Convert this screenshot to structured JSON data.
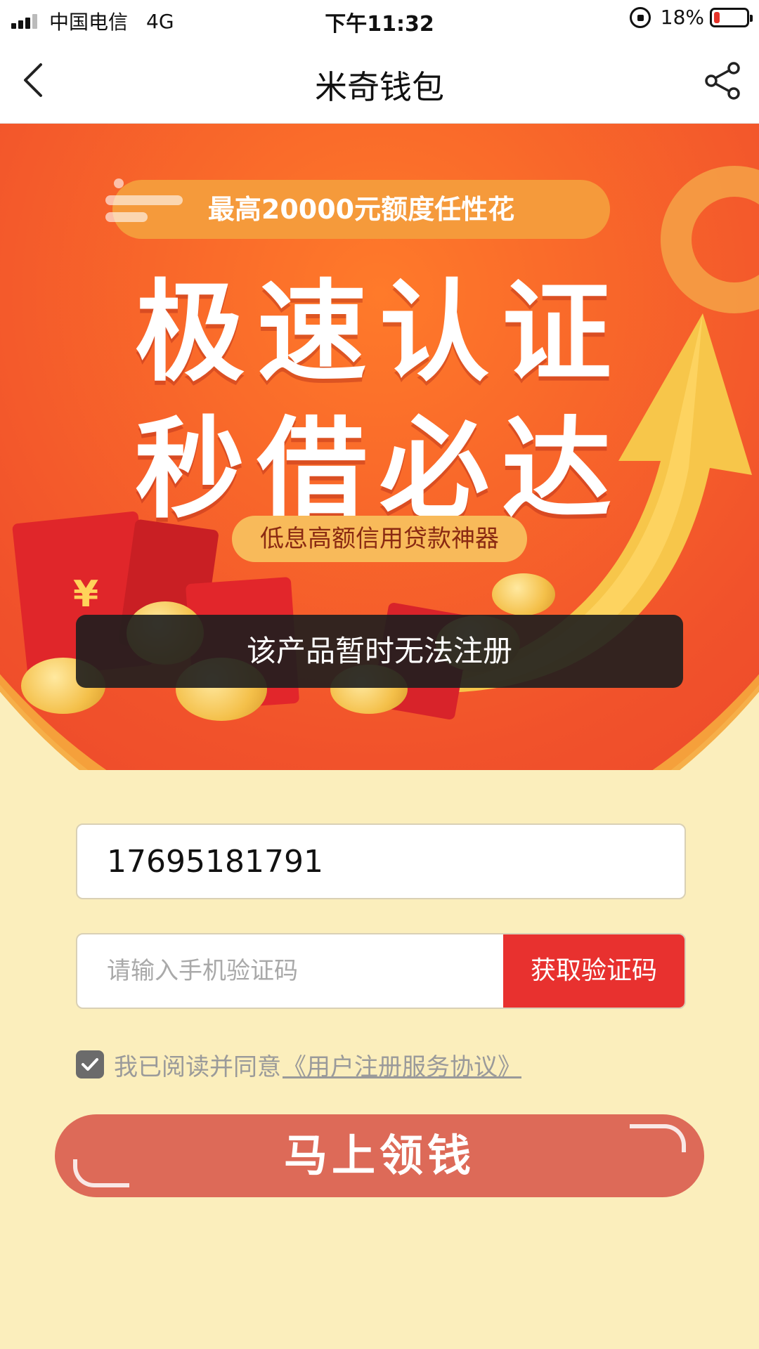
{
  "status_bar": {
    "carrier": "中国电信",
    "network": "4G",
    "time": "下午11:32",
    "battery": "18%",
    "battery_level": 0.18
  },
  "nav": {
    "title": "米奇钱包",
    "back_icon": "chevron-left-icon",
    "share_icon": "share-icon"
  },
  "banner": {
    "top_pill": "最高20000元额度任性花",
    "headline_line1": "极速认证",
    "headline_line2": "秒借必达",
    "sub_pill": "低息高额信用贷款神器",
    "yen_symbol": "¥",
    "colors": {
      "primary": "#e8402a",
      "accent": "#f59a3b"
    }
  },
  "toast": {
    "message": "该产品暂时无法注册"
  },
  "form": {
    "phone_value": "17695181791",
    "code_placeholder": "请输入手机验证码",
    "get_code_label": "获取验证码",
    "agree_text": "我已阅读并同意",
    "agreement_link": "《用户注册服务协议》",
    "agreed": true,
    "submit_label": "马上领钱"
  }
}
